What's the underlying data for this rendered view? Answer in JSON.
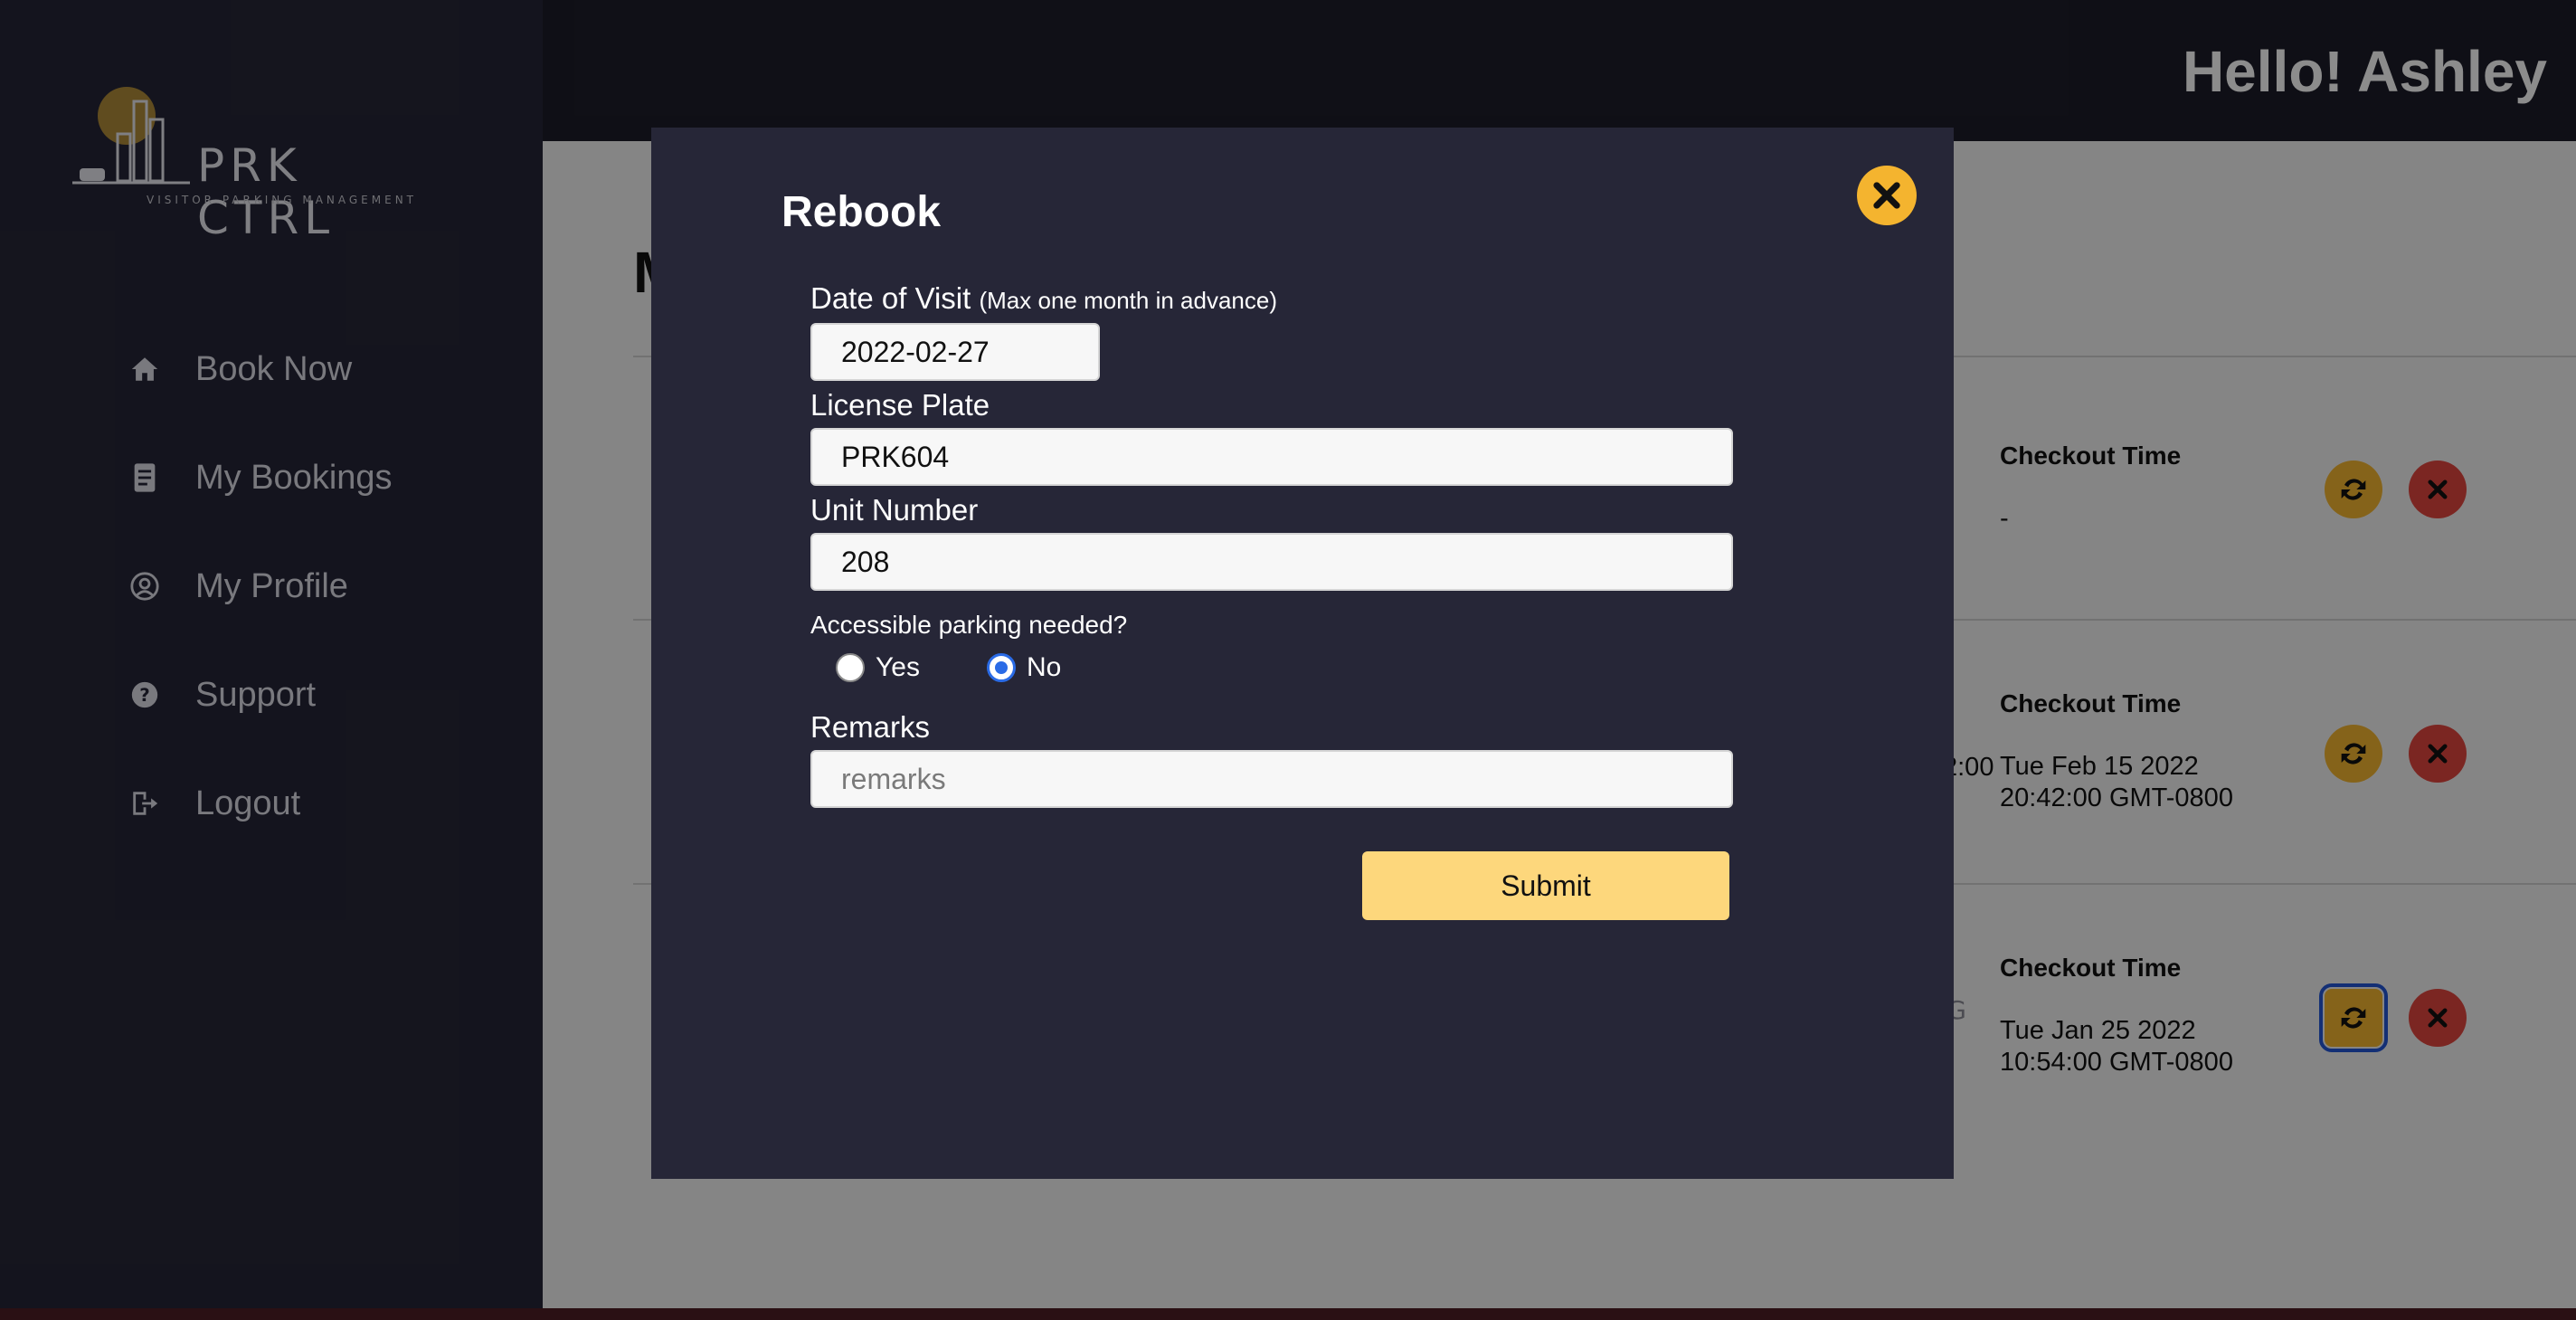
{
  "header": {
    "greeting": "Hello! Ashley"
  },
  "logo": {
    "name": "PRK CTRL",
    "tagline": "VISITOR PARKING MANAGEMENT"
  },
  "sidebar": {
    "items": [
      {
        "label": "Book Now",
        "icon": "home-icon"
      },
      {
        "label": "My Bookings",
        "icon": "document-icon"
      },
      {
        "label": "My Profile",
        "icon": "user-circle-icon"
      },
      {
        "label": "Support",
        "icon": "question-circle-icon"
      },
      {
        "label": "Logout",
        "icon": "logout-icon"
      }
    ]
  },
  "main": {
    "title_partial": "M",
    "bookings": [
      {
        "checkout_label": "Checkout Time",
        "checkout_value_1": "-",
        "checkout_value_2": "",
        "cut_text": ""
      },
      {
        "checkout_label": "Checkout Time",
        "checkout_value_1": "Tue Feb 15 2022",
        "checkout_value_2": "20:42:00 GMT-0800",
        "cut_text": "2:00"
      },
      {
        "checkout_label": "Checkout Time",
        "checkout_value_1": "Tue Jan 25 2022",
        "checkout_value_2": "10:54:00 GMT-0800",
        "cut_text": ""
      }
    ],
    "footer_brand_line1": "VISITOR PARKING",
    "footer_brand_line2": "MANAGEMENT"
  },
  "modal": {
    "title": "Rebook",
    "date_label": "Date of Visit",
    "date_hint": "(Max one month in advance)",
    "date_value": "2022-02-27",
    "plate_label": "License Plate",
    "plate_value": "PRK604",
    "unit_label": "Unit Number",
    "unit_value": "208",
    "accessible_label": "Accessible parking needed?",
    "accessible_options": [
      "Yes",
      "No"
    ],
    "accessible_selected": "No",
    "remarks_label": "Remarks",
    "remarks_placeholder": "remarks",
    "remarks_value": "",
    "submit_label": "Submit"
  },
  "colors": {
    "accent": "#f4b42f",
    "danger": "#e0463e",
    "submit": "#fdd77c",
    "modal_bg": "#262637"
  }
}
